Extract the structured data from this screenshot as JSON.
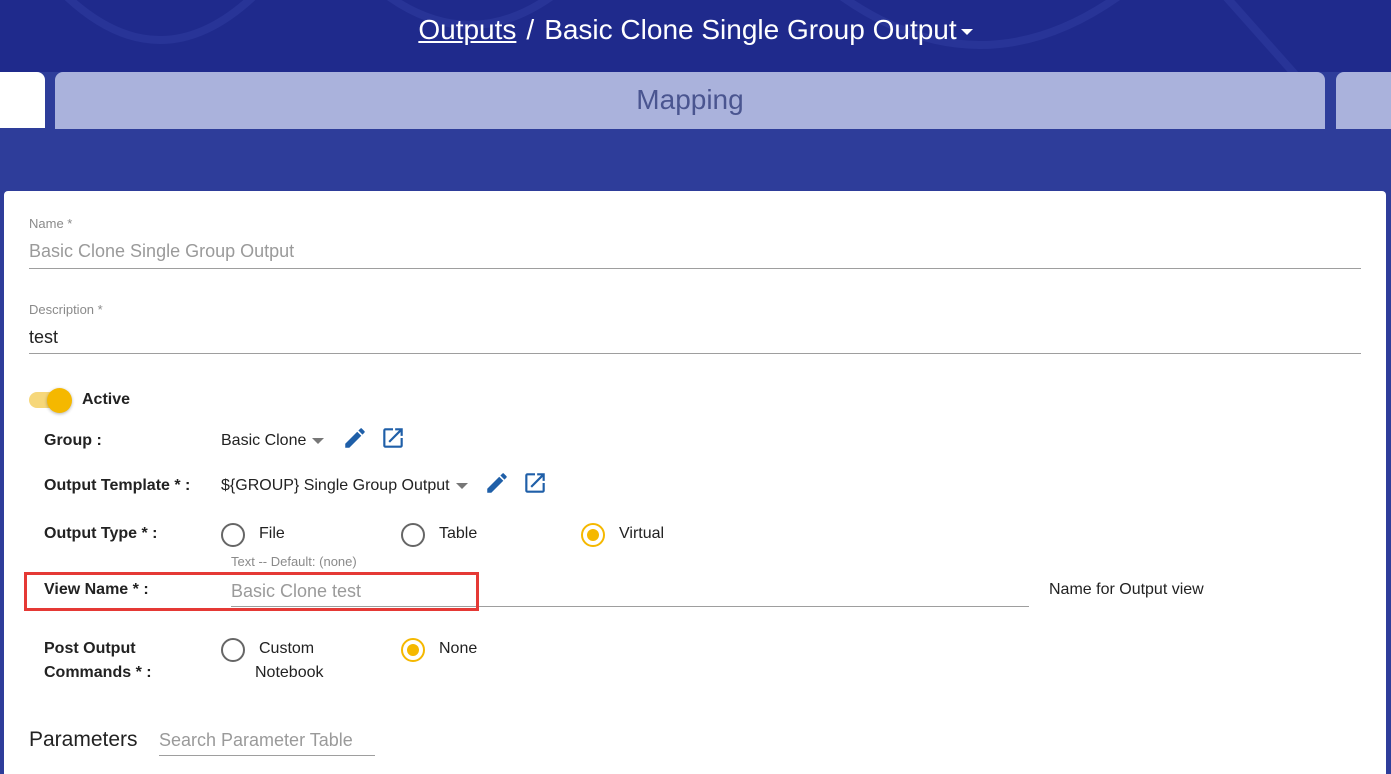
{
  "header": {
    "breadcrumb_link": "Outputs",
    "separator": "/",
    "title": "Basic Clone Single Group Output"
  },
  "tabs": {
    "active_label": "Mapping"
  },
  "form": {
    "name": {
      "label": "Name *",
      "value": "Basic Clone Single Group Output"
    },
    "description": {
      "label": "Description *",
      "value": "test"
    },
    "active": {
      "label": "Active",
      "checked": true
    },
    "group": {
      "label": "Group :",
      "value": "Basic Clone"
    },
    "output_template": {
      "label": "Output Template * :",
      "value": "${GROUP} Single Group Output"
    },
    "output_type": {
      "label": "Output Type * :",
      "options": [
        "File",
        "Table",
        "Virtual"
      ],
      "selected": "Virtual"
    },
    "view_name": {
      "label": "View Name * :",
      "hint": "Text -- Default: (none)",
      "placeholder": "Basic Clone test",
      "help": "Name for Output view"
    },
    "post_output_commands": {
      "label_line1": "Post Output",
      "label_line2": "Commands * :",
      "option_custom_line1": "Custom",
      "option_custom_line2": "Notebook",
      "option_none": "None",
      "selected": "None"
    }
  },
  "parameters": {
    "title": "Parameters",
    "search_placeholder": "Search Parameter Table"
  },
  "colors": {
    "header_bg": "#1f2a8c",
    "page_bg": "#2e3d9a",
    "accent": "#f5b800",
    "icon_blue": "#1f5fa8",
    "highlight": "#e53935"
  }
}
